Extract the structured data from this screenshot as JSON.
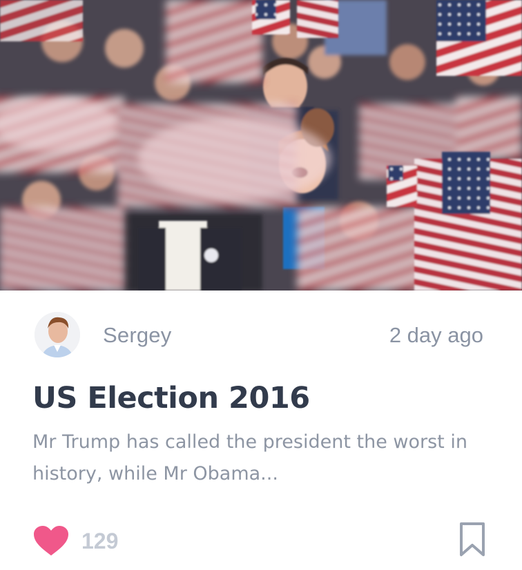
{
  "post": {
    "author_name": "Sergey",
    "timestamp": "2 day ago",
    "title": "US Election 2016",
    "excerpt": "Mr Trump has called the president the worst in history, while Mr Obama...",
    "likes": "129"
  },
  "icons": {
    "like": "heart-icon",
    "bookmark": "bookmark-icon"
  },
  "colors": {
    "heart": "#f0588a",
    "title": "#323b4c",
    "meta_text": "#8a93a3",
    "like_count": "#c4cad4",
    "bookmark_outline": "#9aa2b0"
  }
}
